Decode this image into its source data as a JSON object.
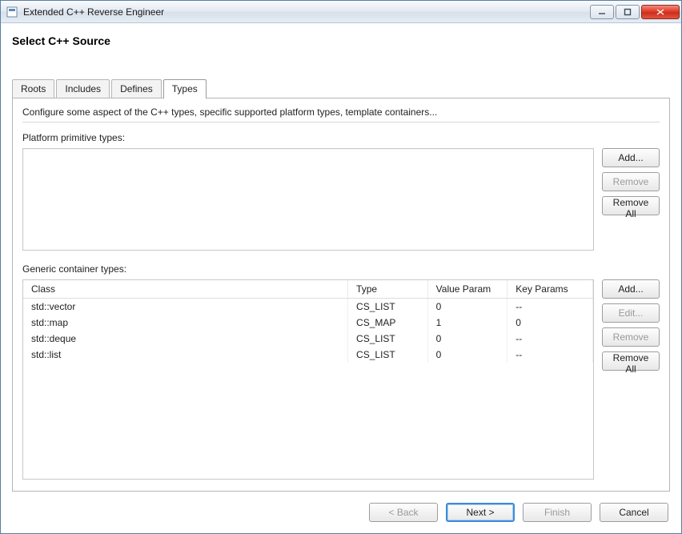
{
  "window": {
    "title": "Extended C++ Reverse Engineer"
  },
  "header": {
    "title": "Select C++ Source"
  },
  "tabs": {
    "roots": "Roots",
    "includes": "Includes",
    "defines": "Defines",
    "types": "Types",
    "active": "types"
  },
  "types_panel": {
    "description": "Configure some aspect of the C++ types, specific supported platform types, template containers...",
    "primitive_label": "Platform primitive types:",
    "generic_label": "Generic container types:",
    "primitive_buttons": {
      "add": "Add...",
      "remove": "Remove",
      "remove_all": "Remove All"
    },
    "generic_buttons": {
      "add": "Add...",
      "edit": "Edit...",
      "remove": "Remove",
      "remove_all": "Remove All"
    },
    "table": {
      "columns": {
        "class": "Class",
        "type": "Type",
        "value_param": "Value Param",
        "key_params": "Key Params"
      },
      "rows": [
        {
          "class": "std::vector",
          "type": "CS_LIST",
          "value_param": "0",
          "key_params": "--"
        },
        {
          "class": "std::map",
          "type": "CS_MAP",
          "value_param": "1",
          "key_params": "0"
        },
        {
          "class": "std::deque",
          "type": "CS_LIST",
          "value_param": "0",
          "key_params": "--"
        },
        {
          "class": "std::list",
          "type": "CS_LIST",
          "value_param": "0",
          "key_params": "--"
        }
      ]
    }
  },
  "footer": {
    "back": "< Back",
    "next": "Next >",
    "finish": "Finish",
    "cancel": "Cancel"
  }
}
